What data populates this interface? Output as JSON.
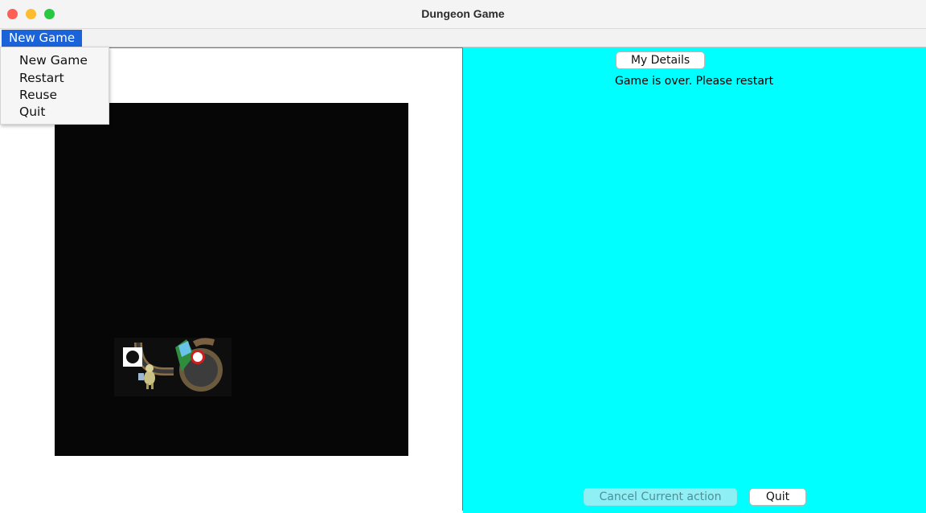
{
  "window": {
    "title": "Dungeon Game"
  },
  "menubar": {
    "menu_label": "New Game"
  },
  "menu": {
    "items": [
      "New Game",
      "Restart",
      "Reuse",
      "Quit"
    ]
  },
  "right_panel": {
    "details_button": "My Details",
    "status": "Game is over. Please restart",
    "cancel_button": "Cancel Current action",
    "quit_button": "Quit"
  },
  "colors": {
    "panel_background": "#00ffff",
    "board_background": "#060606",
    "menu_highlight": "#1a63d8"
  },
  "icons": [
    "close-icon",
    "minimize-icon",
    "zoom-icon",
    "pit-icon",
    "player-icon",
    "treasure-gem-icon",
    "arrow-sign-icon"
  ]
}
